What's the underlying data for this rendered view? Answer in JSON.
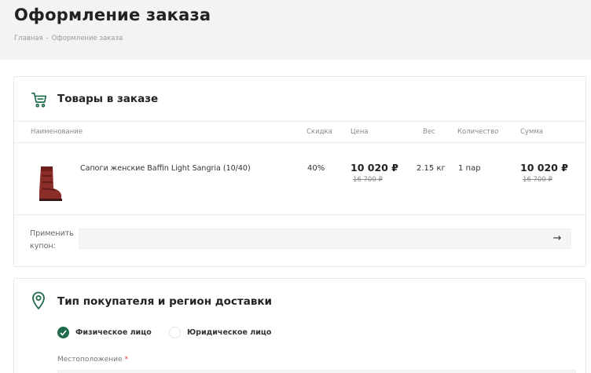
{
  "page": {
    "title": "Оформление заказа",
    "breadcrumb": [
      "Главная",
      "Оформление заказа"
    ],
    "breadcrumb_sep": "-"
  },
  "order": {
    "title": "Товары в заказе",
    "icon": "cart-icon",
    "columns": {
      "name": "Наименование",
      "discount": "Скидка",
      "price": "Цена",
      "weight": "Вес",
      "quantity": "Количество",
      "sum": "Сумма"
    },
    "items": [
      {
        "name": "Сапоги женские Baffin Light Sangria (10/40)",
        "discount": "40%",
        "price": "10 020 ₽",
        "old_price": "16 700 ₽",
        "weight": "2.15 кг",
        "quantity": "1 пар",
        "sum": "10 020 ₽",
        "old_sum": "16 700 ₽",
        "image": "boot-image"
      }
    ],
    "coupon": {
      "label_line1": "Применить",
      "label_line2": "купон:",
      "value": "",
      "button_icon": "arrow-right-icon",
      "button_glyph": "→"
    }
  },
  "delivery": {
    "title": "Тип покупателя и регион доставки",
    "icon": "location-pin-icon",
    "buyer_types": [
      {
        "label": "Физическое лицо",
        "selected": true
      },
      {
        "label": "Юридическое лицо",
        "selected": false
      }
    ],
    "location_label": "Местоположение",
    "required_mark": "*"
  },
  "colors": {
    "accent": "#1f6b4b",
    "background": "#f3f3f3",
    "card_border": "#e6e6e6"
  }
}
